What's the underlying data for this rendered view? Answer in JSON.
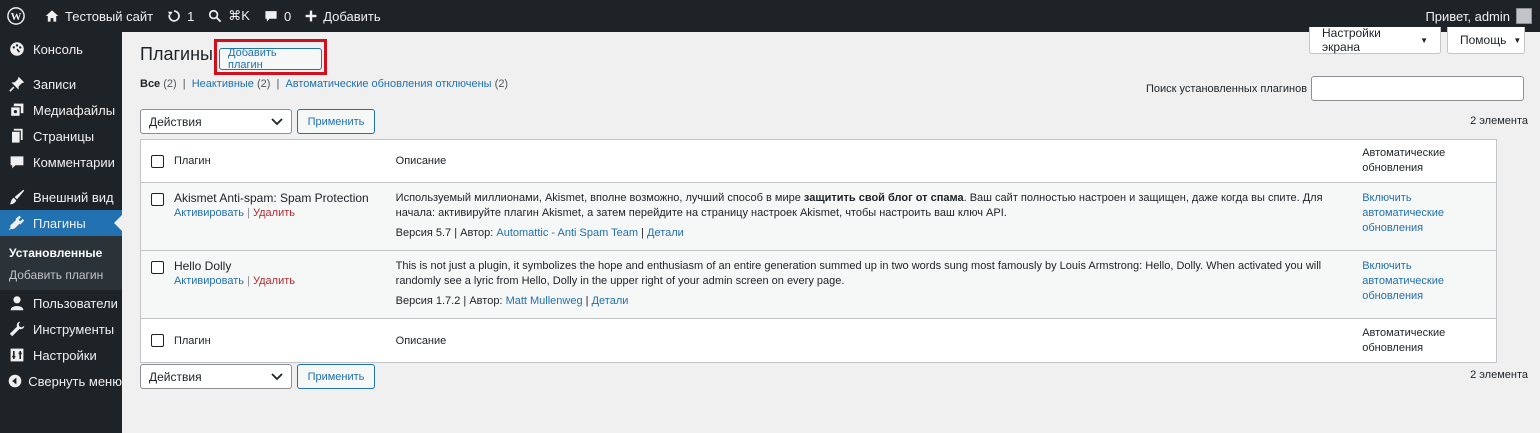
{
  "adminbar": {
    "site_name": "Тестовый сайт",
    "updates_count": "1",
    "search_shortcut": "⌘K",
    "comments_count": "0",
    "new_label": "Добавить",
    "greeting": "Привет, admin"
  },
  "sidebar": {
    "items": [
      {
        "label": "Консоль"
      },
      {
        "label": "Записи"
      },
      {
        "label": "Медиафайлы"
      },
      {
        "label": "Страницы"
      },
      {
        "label": "Комментарии"
      },
      {
        "label": "Внешний вид"
      },
      {
        "label": "Плагины"
      },
      {
        "label": "Пользователи"
      },
      {
        "label": "Инструменты"
      },
      {
        "label": "Настройки"
      },
      {
        "label": "Свернуть меню"
      }
    ],
    "submenu": [
      {
        "label": "Установленные"
      },
      {
        "label": "Добавить плагин"
      }
    ]
  },
  "screen_meta": {
    "screen_options": "Настройки экрана",
    "help": "Помощь"
  },
  "page": {
    "title": "Плагины",
    "add_button": "Добавить плагин",
    "filters": {
      "all": "Все",
      "all_count": "(2)",
      "inactive": "Неактивные",
      "inactive_count": "(2)",
      "auto_off": "Автоматические обновления отключены",
      "auto_off_count": "(2)",
      "sep": "|"
    },
    "search_label": "Поиск установленных плагинов",
    "bulk_action": "Действия",
    "apply": "Применить",
    "items_count": "2 элемента"
  },
  "table": {
    "col_plugin": "Плагин",
    "col_desc": "Описание",
    "col_auto": "Автоматические обновления",
    "rows": [
      {
        "name": "Akismet Anti-spam: Spam Protection",
        "activate": "Активировать",
        "delete": "Удалить",
        "desc_before": "Используемый миллионами, Akismet, вполне возможно, лучший способ в мире ",
        "desc_bold": "защитить свой блог от спама",
        "desc_after": ". Ваш сайт полностью настроен и защищен, даже когда вы спите. Для начала: активируйте плагин Akismet, а затем перейдите на страницу настроек Akismet, чтобы настроить ваш ключ API.",
        "version": "Версия 5.7",
        "author_label": "Автор:",
        "author": "Automattic - Anti Spam Team",
        "details": "Детали",
        "auto_link": "Включить автоматические обновления"
      },
      {
        "name": "Hello Dolly",
        "activate": "Активировать",
        "delete": "Удалить",
        "desc_before": "This is not just a plugin, it symbolizes the hope and enthusiasm of an entire generation summed up in two words sung most famously by Louis Armstrong: Hello, Dolly. When activated you will randomly see a lyric from Hello, Dolly in the upper right of your admin screen on every page.",
        "desc_bold": "",
        "desc_after": "",
        "version": "Версия 1.7.2",
        "author_label": "Автор:",
        "author": "Matt Mullenweg",
        "details": "Детали",
        "auto_link": "Включить автоматические обновления"
      }
    ]
  },
  "colors": {
    "adminbar_bg": "#1d2327",
    "accent": "#2271b1",
    "delete": "#b32d2e",
    "highlight": "#d40f1c"
  }
}
